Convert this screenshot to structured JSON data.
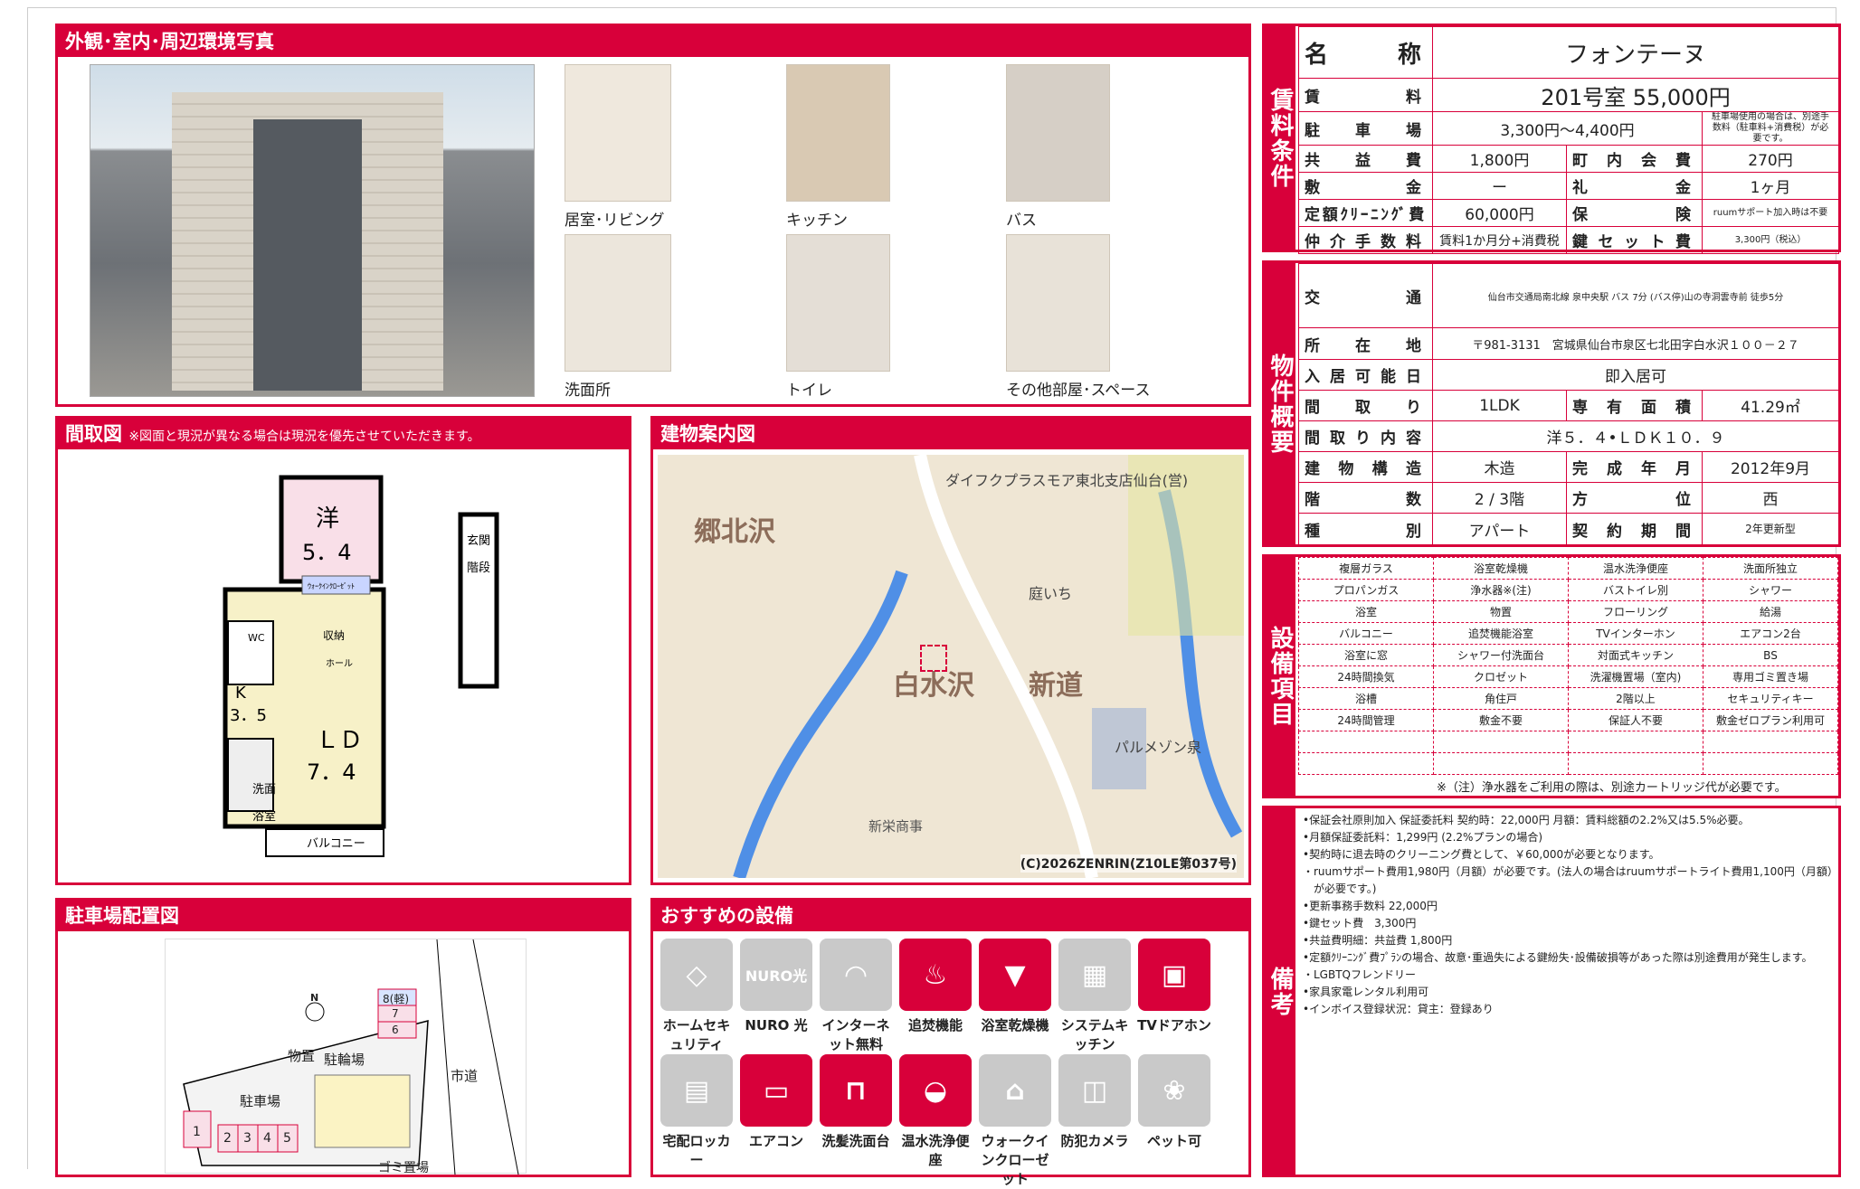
{
  "photos": {
    "title": "外観･室内･周辺環境写真",
    "captions": [
      "居室･リビング",
      "キッチン",
      "バス",
      "洗面所",
      "トイレ",
      "その他部屋･スペース"
    ]
  },
  "floorplan": {
    "title": "間取図",
    "note": "※図面と現況が異なる場合は現況を優先させていただきます。",
    "rooms": {
      "western": "洋",
      "western_size": "5．4",
      "k": "K",
      "k_size": "3．5",
      "ld": "ＬＤ",
      "ld_size": "7．4",
      "wc": "WC",
      "closet": "収納",
      "hall": "ホール",
      "washroom": "洗面",
      "bath": "浴室",
      "balcony": "バルコニー",
      "entrance": "玄関",
      "stairs": "階段",
      "walkin": "ｳｫｰｸｲﾝｸﾛｰｾﾞｯﾄ"
    }
  },
  "map": {
    "title": "建物案内図",
    "labels": {
      "a": "郷北沢",
      "b": "白水沢",
      "c": "新道",
      "d": "ダイフクプラスモア東北支店仙台(営)",
      "e": "庭いち",
      "f": "パルメゾン泉",
      "g": "新栄商事",
      "credit": "(C)2026ZENRIN(Z10LE第037号)"
    }
  },
  "parking": {
    "title": "駐車場配置図",
    "labels": {
      "spaces": [
        "1",
        "2",
        "3",
        "4",
        "5",
        "6",
        "7",
        "8(軽)"
      ],
      "lot": "駐車場",
      "bike": "駐輪場",
      "storage": "物置",
      "road": "市道",
      "trash": "ゴミ置場",
      "north": "N"
    }
  },
  "recommend": {
    "title": "おすすめの設備",
    "items": [
      {
        "label": "ホームセキュリティ",
        "on": false,
        "icon": "shield-icon",
        "glyph": "◇"
      },
      {
        "label": "NURO 光",
        "on": false,
        "icon": "nuro-icon",
        "glyph": "NURO光"
      },
      {
        "label": "インターネット無料",
        "on": false,
        "icon": "wifi-icon",
        "glyph": "◠"
      },
      {
        "label": "追焚機能",
        "on": true,
        "icon": "bathtub-icon",
        "glyph": "♨"
      },
      {
        "label": "浴室乾燥機",
        "on": true,
        "icon": "bath-dryer-icon",
        "glyph": "▼"
      },
      {
        "label": "システムキッチン",
        "on": false,
        "icon": "kitchen-icon",
        "glyph": "▦"
      },
      {
        "label": "TVドアホン",
        "on": true,
        "icon": "intercom-icon",
        "glyph": "▣"
      },
      {
        "label": "宅配ロッカー",
        "on": false,
        "icon": "locker-icon",
        "glyph": "▤"
      },
      {
        "label": "エアコン",
        "on": true,
        "icon": "aircon-icon",
        "glyph": "▭"
      },
      {
        "label": "洗髪洗面台",
        "on": true,
        "icon": "washbasin-icon",
        "glyph": "⊓"
      },
      {
        "label": "温水洗浄便座",
        "on": true,
        "icon": "toilet-icon",
        "glyph": "◒"
      },
      {
        "label": "ウォークインクローゼット",
        "on": false,
        "icon": "closet-icon",
        "glyph": "⌂"
      },
      {
        "label": "防犯カメラ",
        "on": false,
        "icon": "camera-icon",
        "glyph": "◫"
      },
      {
        "label": "ペット可",
        "on": false,
        "icon": "paw-icon",
        "glyph": "❀"
      }
    ]
  },
  "terms": {
    "title": "賃料条件",
    "name_label": "名称",
    "name": "フォンテーヌ",
    "rent_label": "賃料",
    "rent": "201号室 55,000円",
    "parking_label": "駐車場",
    "parking": "3,300円～4,400円",
    "parking_note": "駐車場使用の場合は、別途手数料（駐車料+消費税）が必要です。",
    "common_label": "共益費",
    "common": "1,800円",
    "assoc_label": "町内会費",
    "assoc": "270円",
    "deposit_label": "敷金",
    "deposit": "ー",
    "key_money_label": "礼金",
    "key_money": "1ヶ月",
    "cleaning_label": "定額ｸﾘｰﾆﾝｸﾞ費",
    "cleaning": "60,000円",
    "insurance_label": "保険",
    "insurance": "ruumサポート加入時は不要",
    "broker_label": "仲介手数料",
    "broker": "賃料1か月分+消費税",
    "keyset_label": "鍵セット費",
    "keyset": "3,300円（税込）"
  },
  "overview": {
    "title": "物件概要",
    "access_label": "交通",
    "access": "仙台市交通局南北線 泉中央駅 バス 7分 (バス停)山の寺洞雲寺前 徒歩5分",
    "address_label": "所在地",
    "address": "〒981-3131　宮城県仙台市泉区七北田字白水沢１００－２７",
    "movein_label": "入居可能日",
    "movein": "即入居可",
    "layout_label": "間取り",
    "layout": "1LDK",
    "area_label": "専有面積",
    "area": "41.29㎡",
    "detail_label": "間取り内容",
    "detail": "洋５．４•ＬＤＫ１０．９",
    "structure_label": "建物構造",
    "structure": "木造",
    "built_label": "完成年月",
    "built": "2012年9月",
    "floor_label": "階数",
    "floor": "2 / 3階",
    "direction_label": "方位",
    "direction": "西",
    "type_label": "種別",
    "type": "アパート",
    "contract_label": "契約期間",
    "contract": "2年更新型"
  },
  "equipment": {
    "title": "設備項目",
    "rows": [
      [
        "複層ガラス",
        "浴室乾燥機",
        "温水洗浄便座",
        "洗面所独立"
      ],
      [
        "プロパンガス",
        "浄水器※(注)",
        "バストイレ別",
        "シャワー"
      ],
      [
        "浴室",
        "物置",
        "フローリング",
        "給湯"
      ],
      [
        "バルコニー",
        "追焚機能浴室",
        "TVインターホン",
        "エアコン2台"
      ],
      [
        "浴室に窓",
        "シャワー付洗面台",
        "対面式キッチン",
        "BS"
      ],
      [
        "24時間換気",
        "クロゼット",
        "洗濯機置場（室内)",
        "専用ゴミ置き場"
      ],
      [
        "浴槽",
        "角住戸",
        "2階以上",
        "セキュリティキー"
      ],
      [
        "24時間管理",
        "敷金不要",
        "保証人不要",
        "敷金ゼロプラン利用可"
      ]
    ],
    "footnote": "※（注）浄水器をご利用の際は、別途カートリッジ代が必要です。"
  },
  "remarks": {
    "title": "備考",
    "lines": [
      "•保証会社原則加入 保証委託料 契約時：22,000円 月額：賃料総額の2.2%又は5.5%必要。",
      "•月額保証委託料：1,299円 (2.2%プランの場合)",
      "•契約時に退去時のクリーニング費として、￥60,000が必要となります。",
      "・ruumサポート費用1,980円（月額）が必要です。(法人の場合はruumサポートライト費用1,100円（月額）",
      "　が必要です。)",
      "•更新事務手数料 22,000円",
      "•鍵セット費　3,300円",
      "•共益費明細：共益費 1,800円",
      "•定額ｸﾘｰﾆﾝｸﾞ費ﾌﾟﾗﾝの場合、故意･重過失による鍵紛失･設備破損等があった際は別途費用が発生します。",
      "・LGBTQフレンドリー",
      "•家具家電レンタル利用可",
      "•インボイス登録状況：貸主：登録あり"
    ]
  }
}
